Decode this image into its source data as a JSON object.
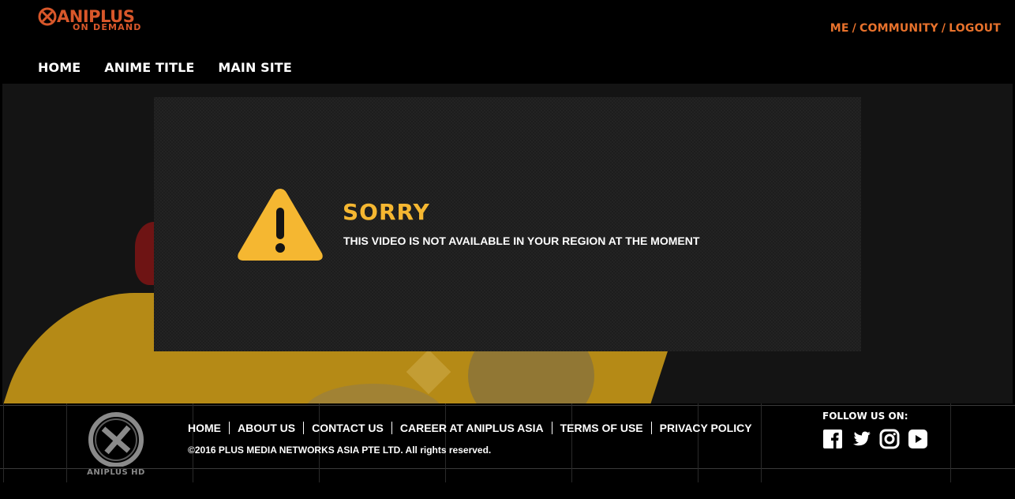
{
  "header": {
    "logo_main": "ANIPLUS",
    "logo_sub": "ON DEMAND",
    "user_links": [
      "ME",
      "COMMUNITY",
      "LOGOUT"
    ],
    "separator": "/"
  },
  "nav": {
    "items": [
      {
        "label": "HOME"
      },
      {
        "label": "ANIME TITLE"
      },
      {
        "label": "MAIN SITE"
      }
    ]
  },
  "message": {
    "title": "SORRY",
    "text": "THIS VIDEO IS NOT AVAILABLE IN YOUR REGION AT THE MOMENT",
    "icon": "warning-icon"
  },
  "footer": {
    "logo_text": "ANIPLUS HD",
    "links": [
      {
        "label": "HOME"
      },
      {
        "label": "ABOUT US"
      },
      {
        "label": "CONTACT US"
      },
      {
        "label": "CAREER AT ANIPLUS ASIA"
      },
      {
        "label": "TERMS OF USE"
      },
      {
        "label": "PRIVACY POLICY"
      }
    ],
    "copyright": "©2016 PLUS MEDIA NETWORKS ASIA PTE LTD. All rights reserved.",
    "follow_label": "FOLLOW US ON:",
    "social": [
      "facebook-icon",
      "twitter-icon",
      "instagram-icon",
      "youtube-icon"
    ]
  },
  "colors": {
    "accent": "#e8722c",
    "warning": "#f5b731",
    "background": "#000000"
  }
}
